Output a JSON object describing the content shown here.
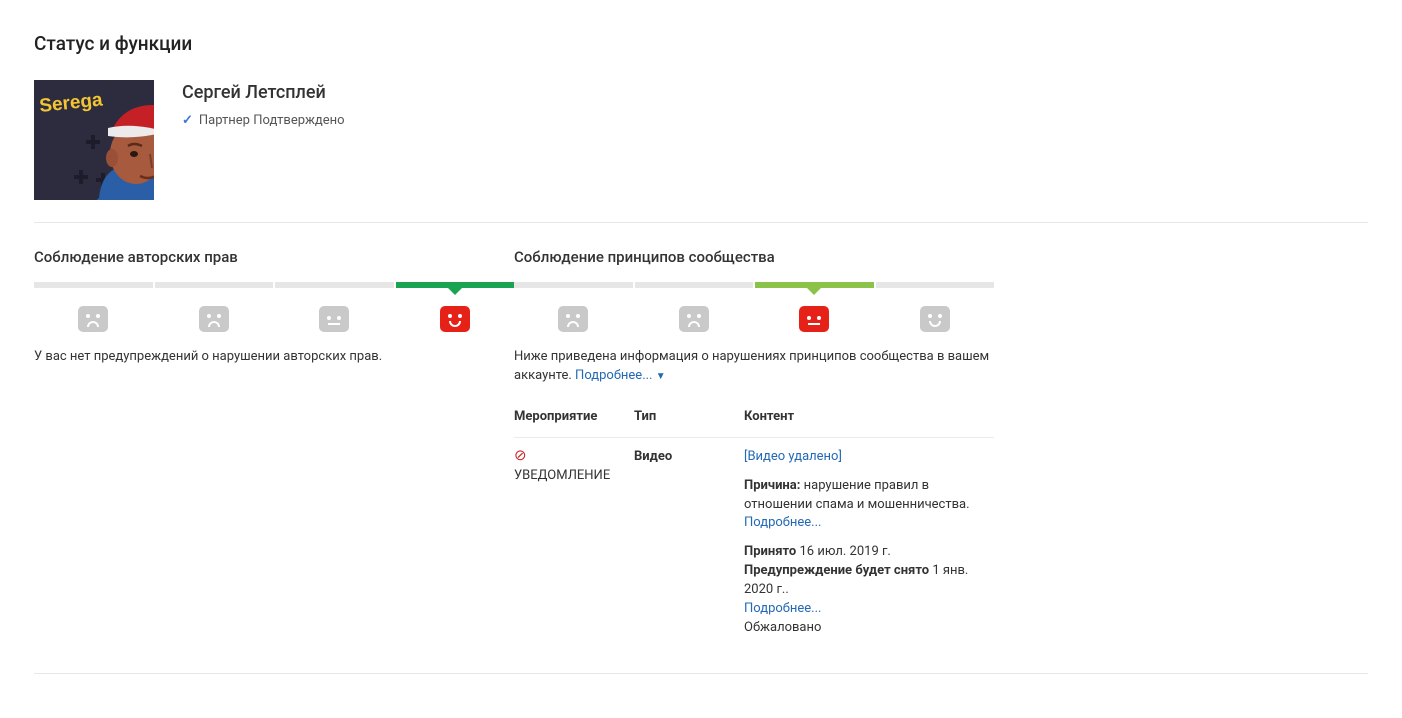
{
  "page": {
    "title": "Статус и функции"
  },
  "channel": {
    "name": "Сергей Летсплей",
    "partner_status": "Партнер Подтверждено",
    "avatar_text": "Serega"
  },
  "copyright": {
    "title": "Соблюдение авторских прав",
    "desc": "У вас нет предупреждений о нарушении авторских прав."
  },
  "community": {
    "title": "Соблюдение принципов сообщества",
    "desc_prefix": "Ниже приведена информация о нарушениях принципов сообщества в вашем аккаунте. ",
    "learn_more": "Подробнее...",
    "table": {
      "headers": {
        "event": "Мероприятие",
        "type": "Тип",
        "content": "Контент"
      },
      "row": {
        "event_label": "УВЕДОМЛЕНИЕ",
        "type_value": "Видео",
        "video_link": "[Видео удалено]",
        "reason_label": "Причина:",
        "reason_value": " нарушение правил в отношении спама и мошенничества.",
        "reason_more": "Подробнее...",
        "accepted_label": "Принято",
        "accepted_value": " 16 июл. 2019 г.",
        "expire_label": "Предупреждение будет снято",
        "expire_value": " 1 янв. 2020 г..",
        "expire_more": "Подробнее...",
        "appeal_status": "Обжаловано"
      }
    }
  }
}
